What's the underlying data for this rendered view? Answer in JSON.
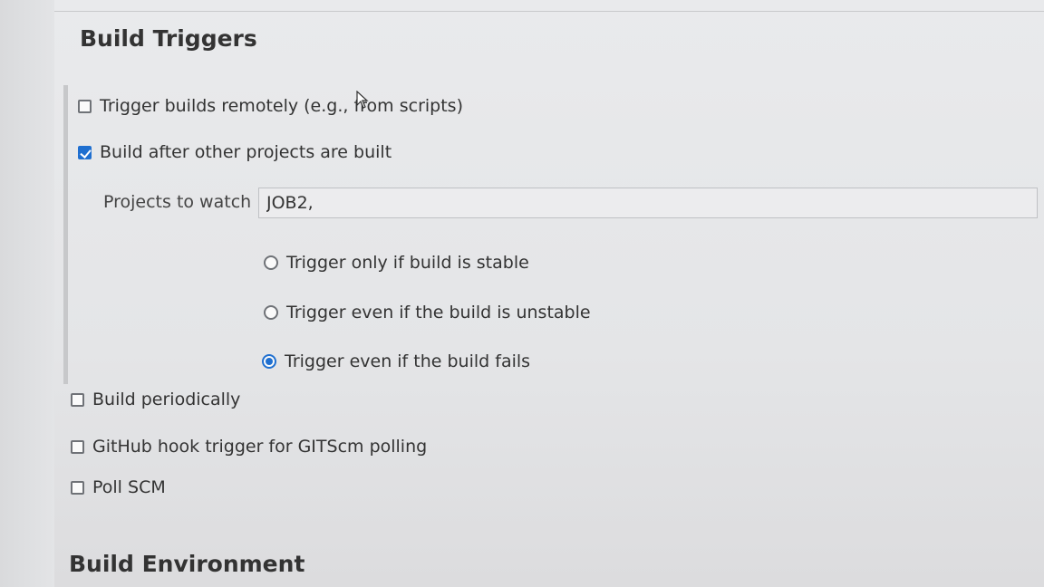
{
  "build_triggers": {
    "title": "Build Triggers",
    "options": {
      "trigger_remotely": {
        "label": "Trigger builds remotely (e.g., from scripts)",
        "checked": false
      },
      "build_after_other": {
        "label": "Build after other projects are built",
        "checked": true
      }
    },
    "projects_to_watch": {
      "label": "Projects to watch",
      "value": "JOB2,"
    },
    "radio_options": [
      {
        "label": "Trigger only if build is stable",
        "selected": false
      },
      {
        "label": "Trigger even if the build is unstable",
        "selected": false
      },
      {
        "label": "Trigger even if the build fails",
        "selected": true
      }
    ],
    "other_options": {
      "build_periodically": {
        "label": "Build periodically",
        "checked": false
      },
      "github_hook": {
        "label": "GitHub hook trigger for GITScm polling",
        "checked": false
      },
      "poll_scm": {
        "label": "Poll SCM",
        "checked": false
      }
    }
  },
  "build_environment": {
    "title": "Build Environment"
  },
  "icons": {
    "cursor": "mouse-pointer-icon",
    "checkbox": "checkbox-icon",
    "radio": "radio-button-icon"
  },
  "colors": {
    "accent": "#1f6fd0",
    "text": "#333333",
    "background": "#e6e7e9"
  }
}
